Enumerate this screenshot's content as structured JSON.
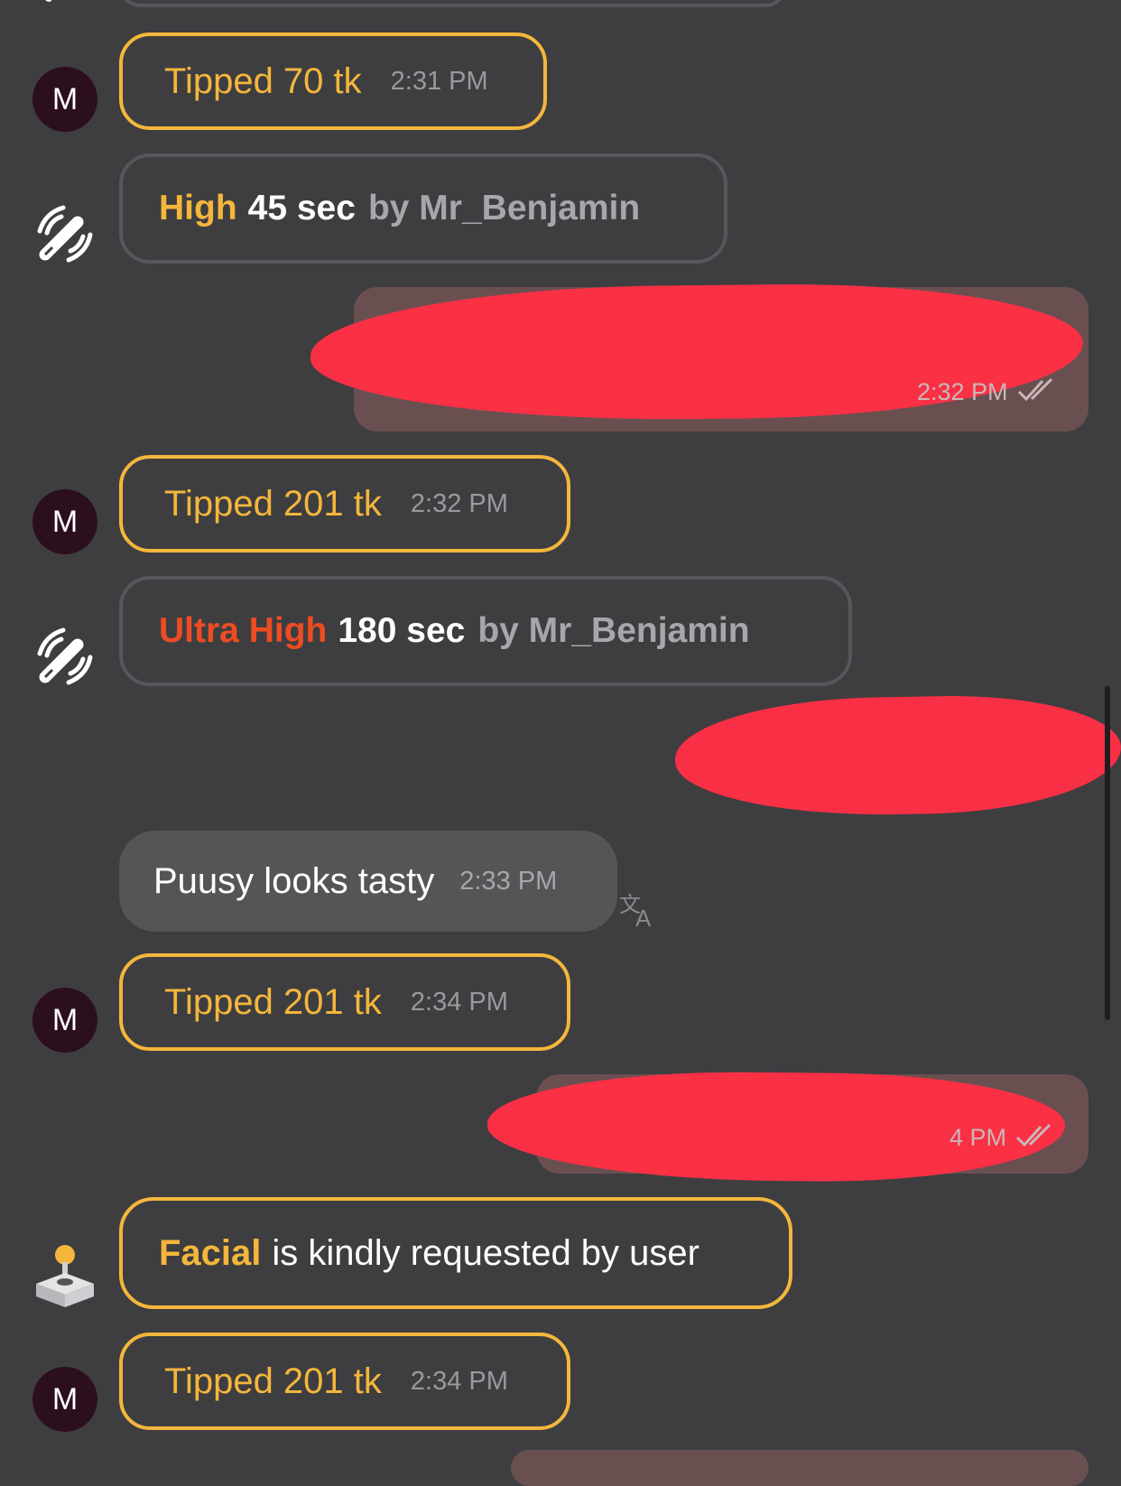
{
  "tips": [
    {
      "amount": "Tipped 70 tk",
      "time": "2:31 PM",
      "avatar": "M"
    },
    {
      "amount": "Tipped 201 tk",
      "time": "2:32 PM",
      "avatar": "M"
    },
    {
      "amount": "Tipped 201 tk",
      "time": "2:34 PM",
      "avatar": "M"
    },
    {
      "amount": "Tipped 201 tk",
      "time": "2:34 PM",
      "avatar": "M"
    }
  ],
  "vibrations": [
    {
      "level": "High",
      "duration": "45 sec",
      "by": "by Mr_Benjamin"
    },
    {
      "level": "Ultra High",
      "duration": "180 sec",
      "by": "by Mr_Benjamin"
    }
  ],
  "own_messages": [
    {
      "time": "2:32 PM",
      "status_icon": "double-check-icon"
    },
    {
      "time": "4 PM",
      "status_icon": "double-check-icon"
    }
  ],
  "incoming_message": {
    "text": "Puusy looks tasty",
    "time": "2:33 PM",
    "translate_icon": "translate-icon"
  },
  "request": {
    "name": "Facial",
    "text": "is kindly requested by user",
    "icon": "joystick-icon"
  },
  "colors": {
    "background": "#3e3e40",
    "tip_accent": "#f4b63c",
    "ultra_high": "#ee4c22",
    "redaction": "#ff2f45"
  }
}
